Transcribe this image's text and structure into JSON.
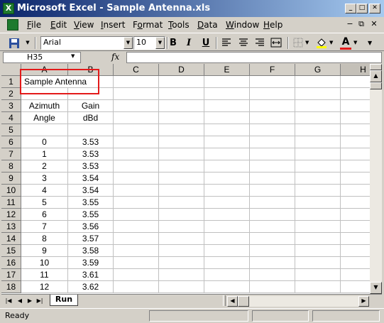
{
  "window": {
    "title": "Microsoft Excel - Sample Antenna.xls",
    "app_icon": "excel-icon"
  },
  "caption_buttons": [
    "_",
    "□",
    "✕"
  ],
  "menu": [
    "File",
    "Edit",
    "View",
    "Insert",
    "Format",
    "Tools",
    "Data",
    "Window",
    "Help"
  ],
  "menu_hotkeys": [
    "F",
    "E",
    "V",
    "I",
    "o",
    "T",
    "D",
    "W",
    "H"
  ],
  "doc_buttons": [
    "−",
    "⧉",
    "✕"
  ],
  "toolbar": {
    "font": "Arial",
    "size": "10",
    "bold": "B",
    "italic": "I",
    "underline": "U",
    "font_color_glyph": "A"
  },
  "formula": {
    "name_box": "H35",
    "fx": "fx",
    "content": ""
  },
  "columns": [
    "A",
    "B",
    "C",
    "D",
    "E",
    "F",
    "G",
    "H"
  ],
  "rows": [
    {
      "n": "1",
      "a": "Sample Antenna",
      "b": ""
    },
    {
      "n": "2",
      "a": "",
      "b": ""
    },
    {
      "n": "3",
      "a": "Azimuth",
      "b": "Gain"
    },
    {
      "n": "4",
      "a": "Angle",
      "b": "dBd"
    },
    {
      "n": "5",
      "a": "",
      "b": ""
    },
    {
      "n": "6",
      "a": "0",
      "b": "3.53"
    },
    {
      "n": "7",
      "a": "1",
      "b": "3.53"
    },
    {
      "n": "8",
      "a": "2",
      "b": "3.53"
    },
    {
      "n": "9",
      "a": "3",
      "b": "3.54"
    },
    {
      "n": "10",
      "a": "4",
      "b": "3.54"
    },
    {
      "n": "11",
      "a": "5",
      "b": "3.55"
    },
    {
      "n": "12",
      "a": "6",
      "b": "3.55"
    },
    {
      "n": "13",
      "a": "7",
      "b": "3.56"
    },
    {
      "n": "14",
      "a": "8",
      "b": "3.57"
    },
    {
      "n": "15",
      "a": "9",
      "b": "3.58"
    },
    {
      "n": "16",
      "a": "10",
      "b": "3.59"
    },
    {
      "n": "17",
      "a": "11",
      "b": "3.61"
    },
    {
      "n": "18",
      "a": "12",
      "b": "3.62"
    }
  ],
  "sheet_tabs": [
    "Run"
  ],
  "status": "Ready",
  "highlight_color": "#e31a1a"
}
